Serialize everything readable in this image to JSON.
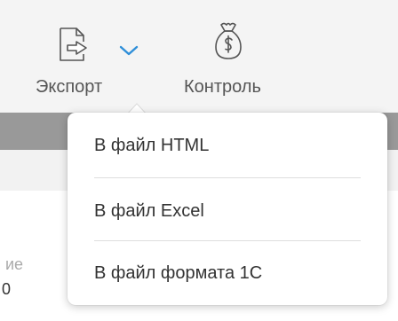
{
  "toolbar": {
    "export": {
      "label": "Экспорт",
      "icon": "export-file-icon",
      "dropdown_icon": "chevron-down-icon"
    },
    "control": {
      "label": "Контроль",
      "icon": "money-bag-icon"
    }
  },
  "export_menu": {
    "items": [
      {
        "label": "В файл HTML"
      },
      {
        "label": "В файл Excel"
      },
      {
        "label": "В файл формата 1С"
      }
    ]
  },
  "background": {
    "partial_label": "ие",
    "partial_value": "0"
  },
  "colors": {
    "accent": "#2f8fd9",
    "band": "#999999",
    "text": "#333333",
    "muted": "#555555"
  }
}
